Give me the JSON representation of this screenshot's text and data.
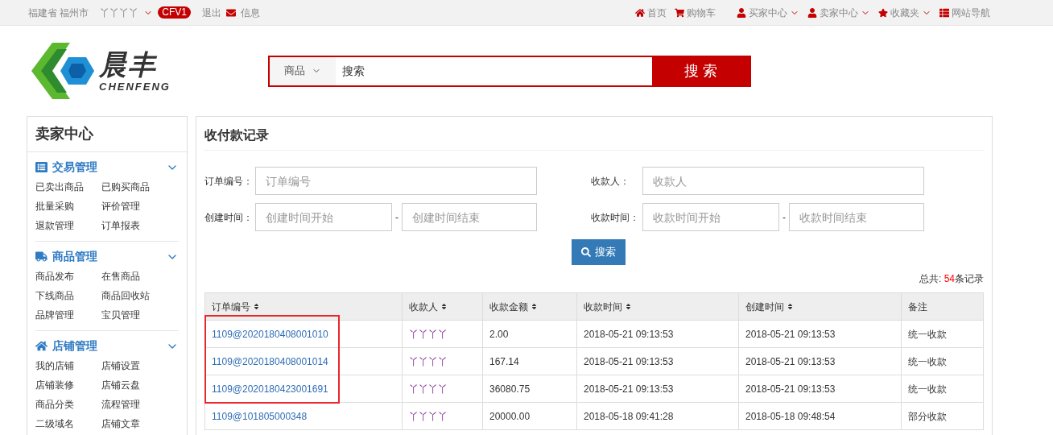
{
  "top_bar": {
    "location": "福建省 福州市",
    "user": "丫丫丫丫",
    "badge": "CFV1",
    "logout": "退出",
    "messages": "信息",
    "links": [
      {
        "kind": "home",
        "label": "首页",
        "dropdown": false
      },
      {
        "kind": "cart",
        "label": "购物车",
        "dropdown": false
      },
      {
        "kind": "user",
        "label": "买家中心",
        "dropdown": true
      },
      {
        "kind": "user",
        "label": "卖家中心",
        "dropdown": true
      },
      {
        "kind": "star",
        "label": "收藏夹",
        "dropdown": true
      },
      {
        "kind": "list",
        "label": "网站导航",
        "dropdown": false
      }
    ]
  },
  "logo": {
    "name": "晨丰",
    "subtitle": "CHENFENG"
  },
  "search": {
    "category": "商品",
    "value": "搜索",
    "button": "搜 索"
  },
  "sidebar": {
    "title": "卖家中心",
    "groups": [
      {
        "kind": "list",
        "title": "交易管理",
        "expanded": true,
        "items": [
          "已卖出商品",
          "已购买商品",
          "批量采购",
          "评价管理",
          "退款管理",
          "订单报表"
        ]
      },
      {
        "kind": "truck",
        "title": "商品管理",
        "expanded": true,
        "items": [
          "商品发布",
          "在售商品",
          "下线商品",
          "商品回收站",
          "品牌管理",
          "宝贝管理"
        ]
      },
      {
        "kind": "home",
        "title": "店铺管理",
        "expanded": true,
        "items": [
          "我的店铺",
          "店铺设置",
          "店铺装修",
          "店铺云盘",
          "商品分类",
          "流程管理",
          "二级域名",
          "店铺文章"
        ]
      }
    ]
  },
  "main": {
    "title": "收付款记录",
    "filters": {
      "order_label": "订单编号：",
      "order_placeholder": "订单编号",
      "payee_label": "收款人：",
      "payee_placeholder": "收款人",
      "created_label": "创建时间：",
      "created_start_placeholder": "创建时间开始",
      "created_end_placeholder": "创建时间结束",
      "paid_label": "收款时间：",
      "paid_start_placeholder": "收款时间开始",
      "paid_end_placeholder": "收款时间结束",
      "separator": "-",
      "button": "搜索"
    },
    "total": {
      "prefix": "总共: ",
      "count": "54",
      "suffix": "条记录"
    },
    "table": {
      "columns": [
        {
          "label": "订单编号",
          "sortable": true
        },
        {
          "label": "收款人",
          "sortable": true
        },
        {
          "label": "收款金额",
          "sortable": true
        },
        {
          "label": "收款时间",
          "sortable": true
        },
        {
          "label": "创建时间",
          "sortable": true
        },
        {
          "label": "备注",
          "sortable": false
        }
      ],
      "rows": [
        {
          "highlighted": true,
          "cells": [
            "1109@2020180408001010",
            "丫丫丫丫",
            "2.00",
            "2018-05-21 09:13:53",
            "2018-05-21 09:13:53",
            "统一收款"
          ]
        },
        {
          "highlighted": true,
          "cells": [
            "1109@2020180408001014",
            "丫丫丫丫",
            "167.14",
            "2018-05-21 09:13:53",
            "2018-05-21 09:13:53",
            "统一收款"
          ]
        },
        {
          "highlighted": true,
          "cells": [
            "1109@2020180423001691",
            "丫丫丫丫",
            "36080.75",
            "2018-05-21 09:13:53",
            "2018-05-21 09:13:53",
            "统一收款"
          ]
        },
        {
          "highlighted": false,
          "cells": [
            "1109@101805000348",
            "丫丫丫丫",
            "20000.00",
            "2018-05-18 09:41:28",
            "2018-05-18 09:48:54",
            "部分收款"
          ]
        }
      ]
    }
  }
}
